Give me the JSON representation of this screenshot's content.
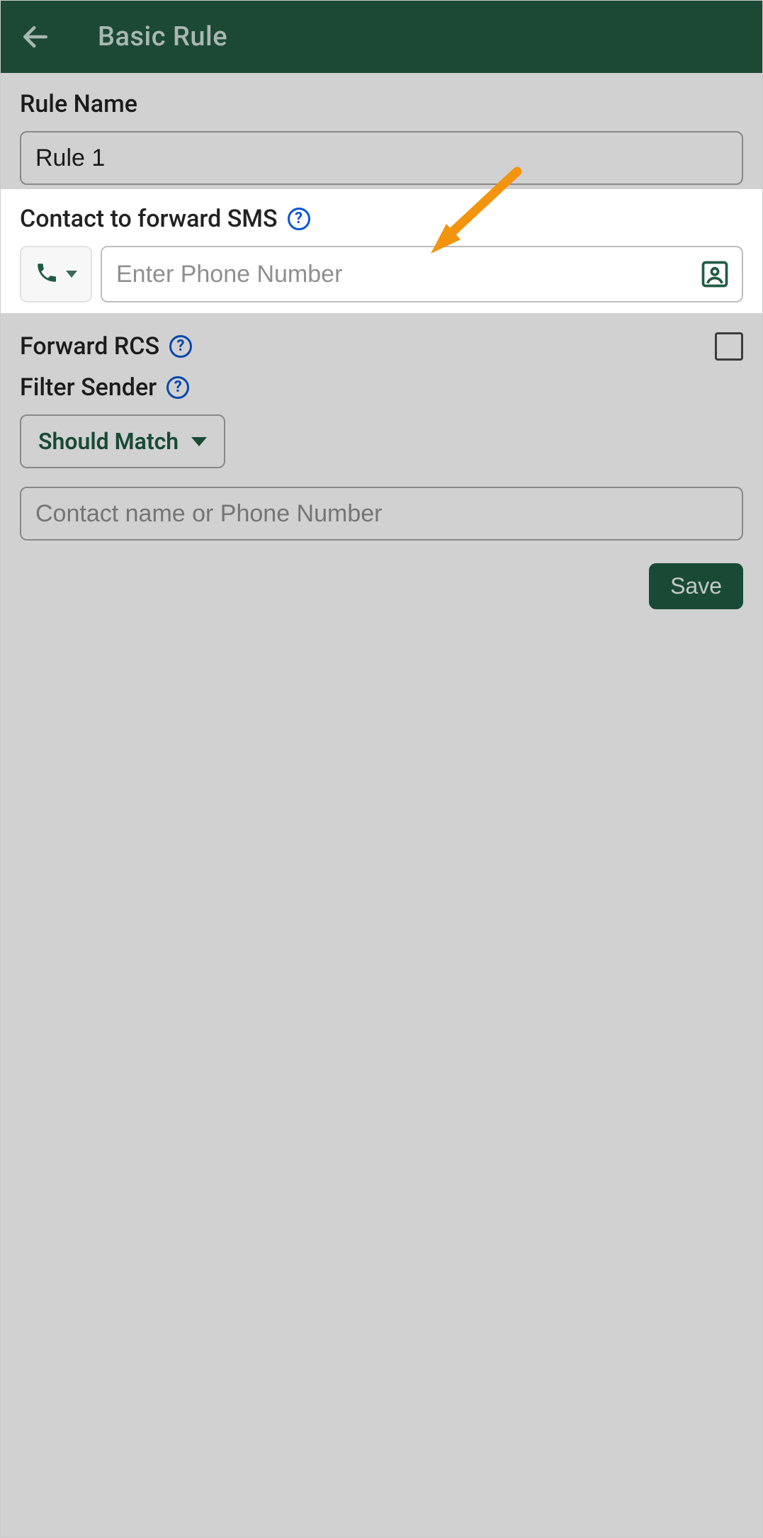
{
  "header": {
    "title": "Basic Rule"
  },
  "rule_name": {
    "label": "Rule Name",
    "value": "Rule 1"
  },
  "contact_forward": {
    "label": "Contact to forward SMS",
    "phone_placeholder": "Enter Phone Number"
  },
  "forward_rcs": {
    "label": "Forward RCS",
    "checked": false
  },
  "filter_sender": {
    "label": "Filter Sender",
    "match_mode": "Should Match",
    "filter_placeholder": "Contact name or Phone Number"
  },
  "actions": {
    "save_label": "Save"
  },
  "colors": {
    "accent": "#1f5b43",
    "header": "#225943",
    "help": "#0a57d0",
    "annotation": "#f3940e"
  }
}
